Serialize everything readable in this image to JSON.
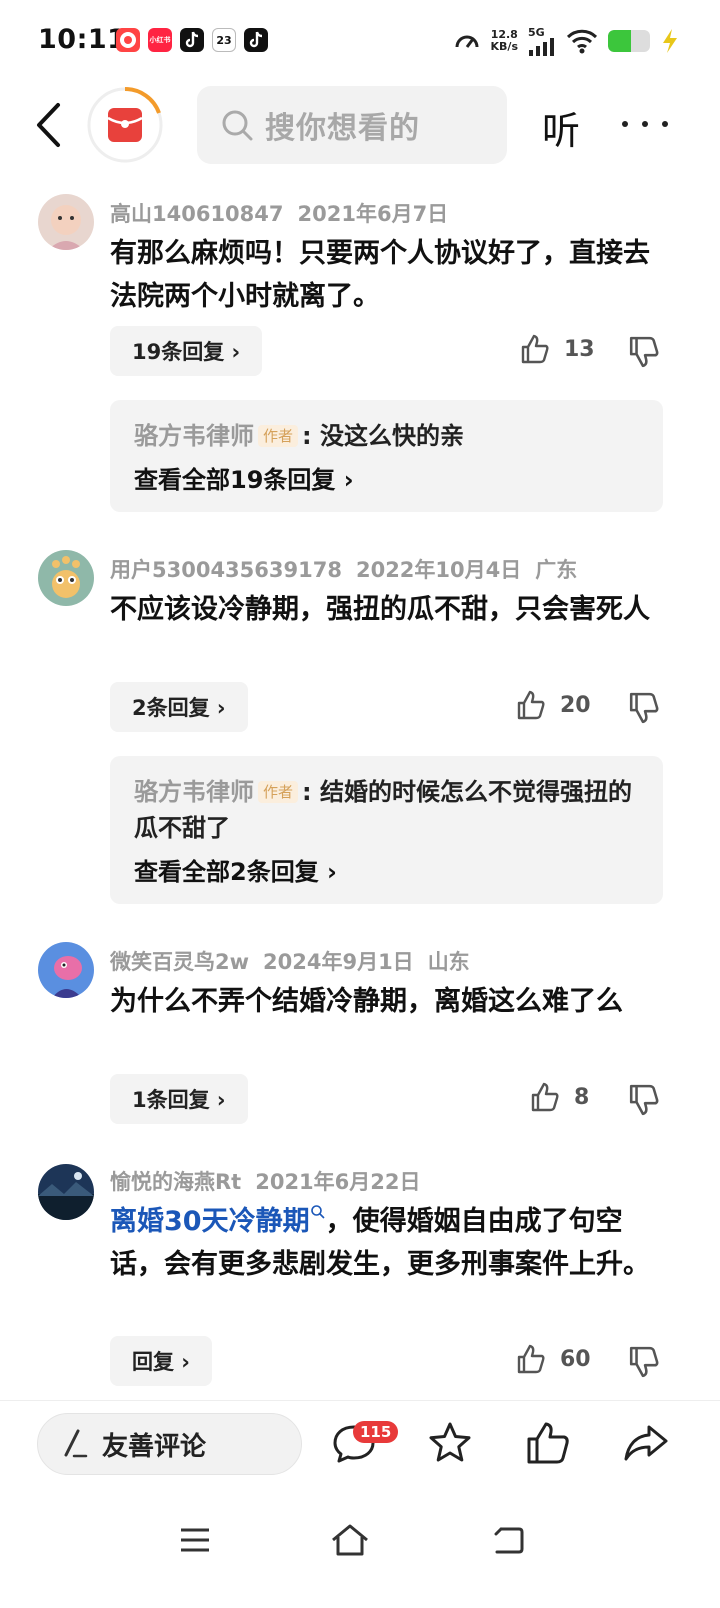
{
  "status_bar": {
    "time": "10:11",
    "net_speed_value": "12.8",
    "net_speed_unit": "KB/s",
    "network": "5G",
    "battery_level": 0.55,
    "app_icons": [
      "toutiao-icon",
      "xiaohongshu-icon",
      "douyin-icon",
      "calendar-icon",
      "tiktok-icon"
    ],
    "calendar_day": "23",
    "xiaohongshu_label": "小红书"
  },
  "header": {
    "search_placeholder": "搜你想看的",
    "listen_label": "听"
  },
  "comments": [
    {
      "user": "高山140610847",
      "date": "2021年6月7日",
      "location": "",
      "text": "有那么麻烦吗！只要两个人协议好了，直接去法院两个小时就离了。",
      "reply_button": "19条回复 ›",
      "likes": "13",
      "thread": {
        "author": "骆方韦律师",
        "tag": "作者",
        "reply": ": 没这么快的亲",
        "view_all": "查看全部19条回复 ›"
      }
    },
    {
      "user": "用户5300435639178",
      "date": "2022年10月4日",
      "location": "广东",
      "text": "不应该设冷静期，强扭的瓜不甜，只会害死人",
      "reply_button": "2条回复 ›",
      "likes": "20",
      "thread": {
        "author": "骆方韦律师",
        "tag": "作者",
        "reply": ": 结婚的时候怎么不觉得强扭的瓜不甜了",
        "view_all": "查看全部2条回复 ›"
      }
    },
    {
      "user": "微笑百灵鸟2w",
      "date": "2024年9月1日",
      "location": "山东",
      "text": "为什么不弄个结婚冷静期，离婚这么难了么",
      "reply_button": "1条回复 ›",
      "likes": "8"
    },
    {
      "user": "愉悦的海燕Rt",
      "date": "2021年6月22日",
      "location": "",
      "link_text": "离婚30天冷静期",
      "text": "，使得婚姻自由成了句空话，会有更多悲剧发生，更多刑事案件上升。",
      "reply_button": "回复 ›",
      "likes": "60"
    }
  ],
  "bottom_bar": {
    "comment_placeholder": "友善评论",
    "comment_count_badge": "115"
  },
  "colors": {
    "link": "#1b57b8",
    "badge": "#e83a3a",
    "author_tag": "#d5a15a",
    "logo": "#e8413c"
  }
}
